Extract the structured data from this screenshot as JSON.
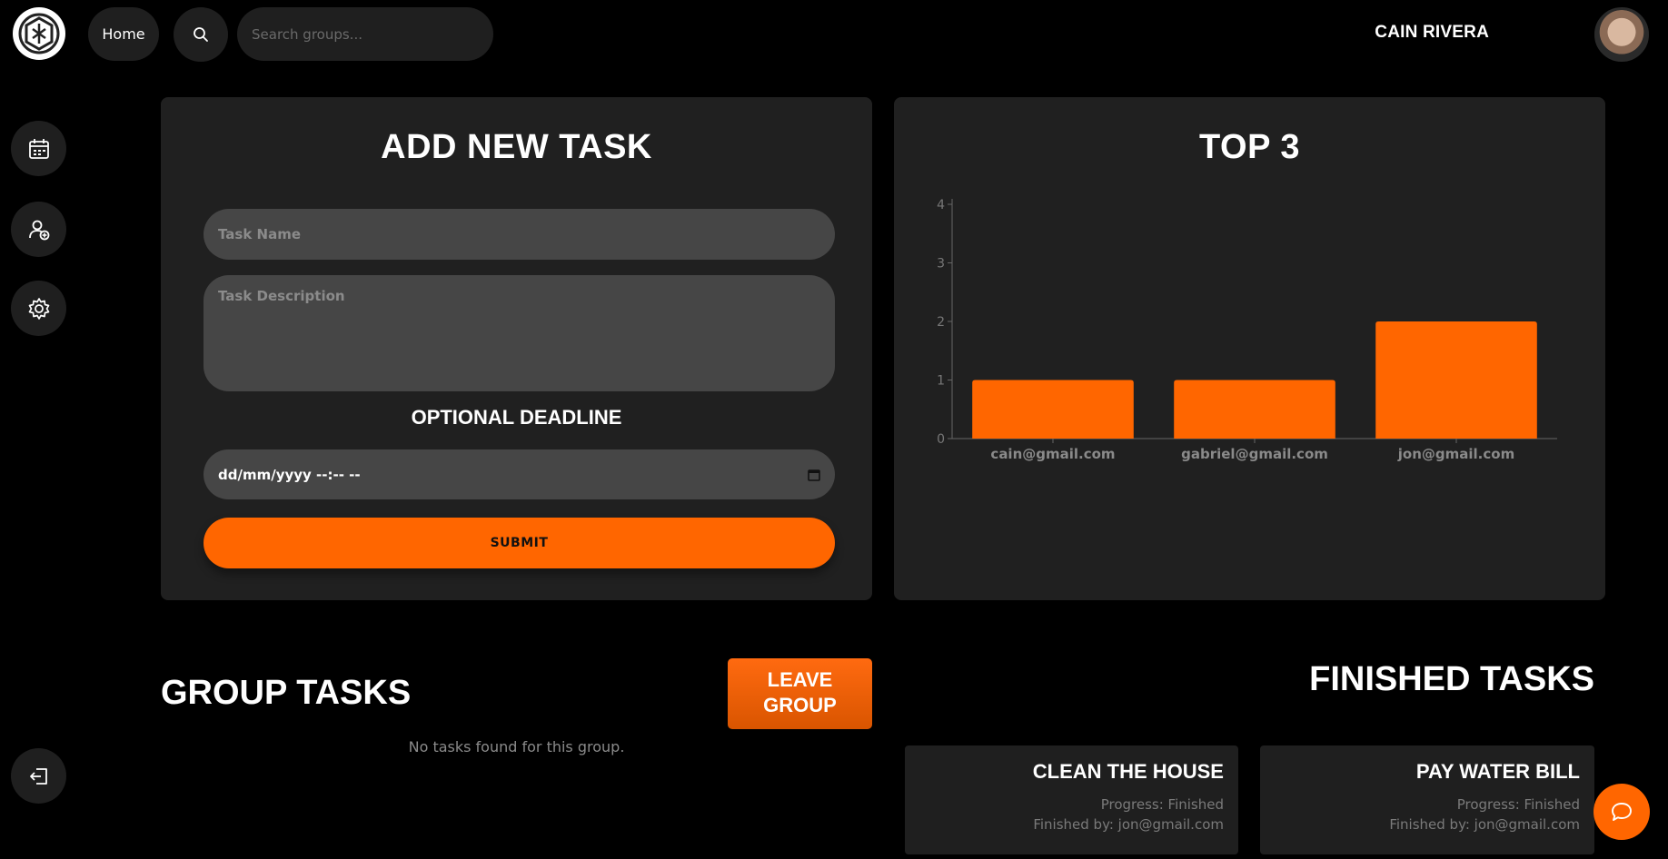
{
  "header": {
    "home_label": "Home",
    "search_placeholder": "Search groups...",
    "user_name": "CAIN RIVERA"
  },
  "sidebar": {
    "items": [
      {
        "icon": "calendar-icon"
      },
      {
        "icon": "add-user-icon"
      },
      {
        "icon": "gear-icon"
      }
    ],
    "logout_icon": "logout-icon"
  },
  "add_task": {
    "title": "ADD NEW TASK",
    "name_placeholder": "Task Name",
    "description_placeholder": "Task Description",
    "deadline_label": "OPTIONAL DEADLINE",
    "deadline_value": "dd/mm/yyyy --:-- --",
    "submit_label": "SUBMIT"
  },
  "top3": {
    "title": "TOP 3"
  },
  "chart_data": {
    "type": "bar",
    "categories": [
      "cain@gmail.com",
      "gabriel@gmail.com",
      "jon@gmail.com"
    ],
    "values": [
      1,
      1,
      2
    ],
    "ylim": [
      0,
      4
    ],
    "yticks": [
      0,
      1,
      2,
      3,
      4
    ],
    "bar_color": "#ff6600",
    "grid": false,
    "legend": "none"
  },
  "group_tasks": {
    "title": "GROUP TASKS",
    "leave_label_line1": "LEAVE",
    "leave_label_line2": "GROUP",
    "empty_message": "No tasks found for this group."
  },
  "finished_tasks": {
    "title": "FINISHED TASKS",
    "cards": [
      {
        "title": "CLEAN THE HOUSE",
        "progress": "Progress: Finished",
        "finished_by": "Finished by: jon@gmail.com"
      },
      {
        "title": "PAY WATER BILL",
        "progress": "Progress: Finished",
        "finished_by": "Finished by: jon@gmail.com"
      }
    ]
  },
  "colors": {
    "accent": "#ff6600",
    "panel": "#202020",
    "background": "#000000"
  }
}
